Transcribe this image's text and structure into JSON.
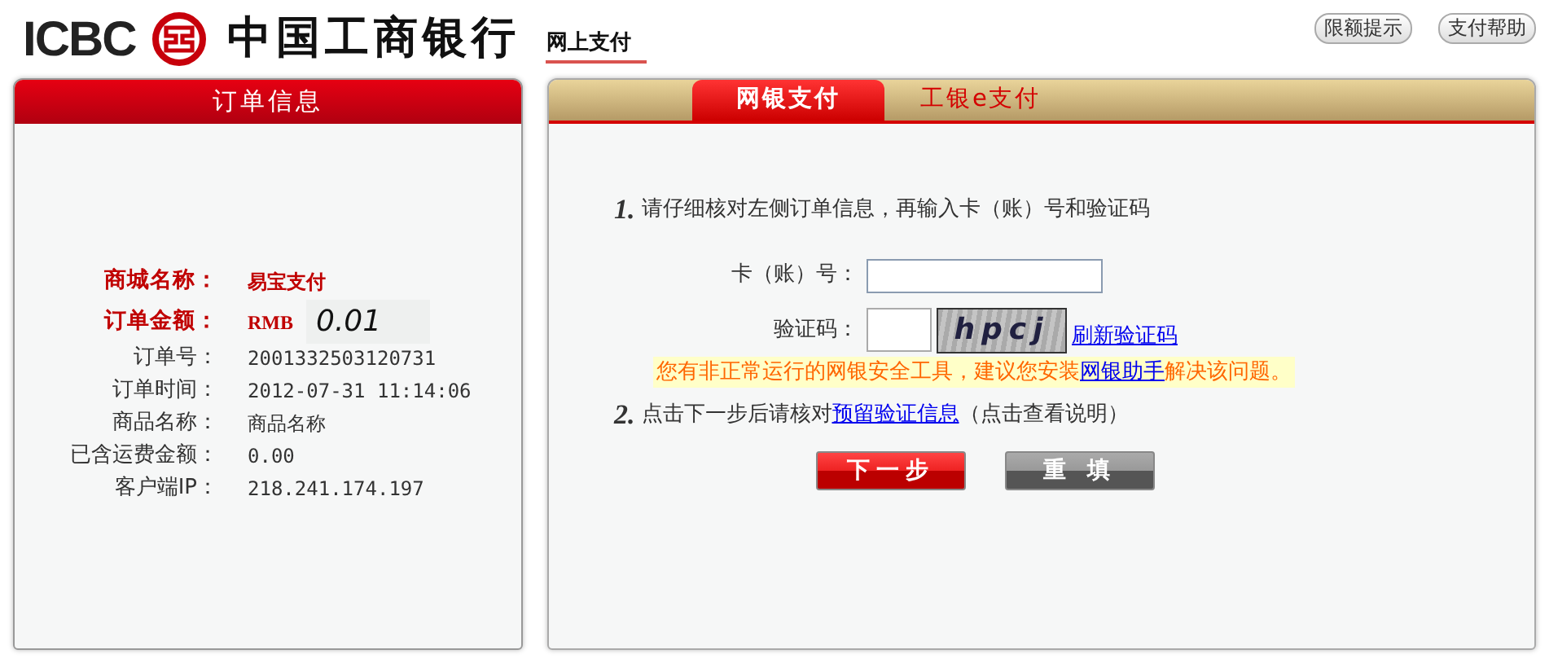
{
  "header": {
    "brand": "ICBC",
    "bank_name": "中国工商银行",
    "service": "网上支付",
    "buttons": [
      "限额提示",
      "支付帮助"
    ]
  },
  "order_panel": {
    "title": "订单信息",
    "rows": [
      {
        "kind": "highlight",
        "label": "商城名称：",
        "value": "易宝支付"
      },
      {
        "kind": "amount",
        "label": "订单金额：",
        "currency": "RMB",
        "value": "0.01"
      },
      {
        "kind": "normal",
        "label": "订单号：",
        "value": "2001332503120731"
      },
      {
        "kind": "normal",
        "label": "订单时间：",
        "value": "2012-07-31 11:14:06"
      },
      {
        "kind": "normal",
        "label": "商品名称：",
        "value": "商品名称"
      },
      {
        "kind": "normal",
        "label": "已含运费金额：",
        "value": "0.00"
      },
      {
        "kind": "normal",
        "label": "客户端IP：",
        "value": "218.241.174.197"
      }
    ]
  },
  "payment_panel": {
    "tabs": [
      {
        "label": "网银支付",
        "selected": true
      },
      {
        "label": "工银e支付",
        "selected": false
      }
    ],
    "step_1": {
      "number": "1.",
      "text": "请仔细核对左侧订单信息，再输入卡（账）号和验证码"
    },
    "card_field": {
      "label": "卡（账）号："
    },
    "captcha_field": {
      "label": "验证码：",
      "captcha_text": "hpcj",
      "refresh_link": "刷新验证码"
    },
    "warning": {
      "before": "您有非正常运行的网银安全工具，建议您安装",
      "link": "网银助手",
      "after": "解决该问题。"
    },
    "step_2": {
      "number": "2.",
      "before": "点击下一步后请核对",
      "link": "预留验证信息",
      "after": "（点击查看说明）"
    },
    "buttons": [
      {
        "kind": "primary",
        "label": "下一步"
      },
      {
        "kind": "secondary",
        "label": "重 填"
      }
    ]
  }
}
